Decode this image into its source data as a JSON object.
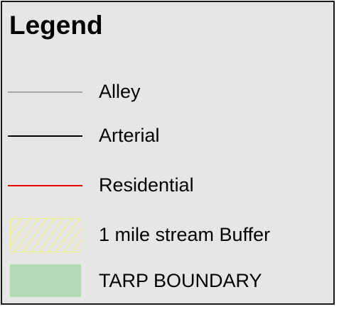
{
  "legend": {
    "title": "Legend",
    "items": [
      {
        "label": "Alley",
        "swatch": "line",
        "color": "#a6a6a6"
      },
      {
        "label": "Arterial",
        "swatch": "line",
        "color": "#000000"
      },
      {
        "label": "Residential",
        "swatch": "line",
        "color": "#e60000"
      },
      {
        "label": "1 mile stream Buffer",
        "swatch": "hatch",
        "color": "#f4f49a"
      },
      {
        "label": "TARP BOUNDARY",
        "swatch": "fill",
        "color": "#b4d9b4"
      }
    ]
  }
}
